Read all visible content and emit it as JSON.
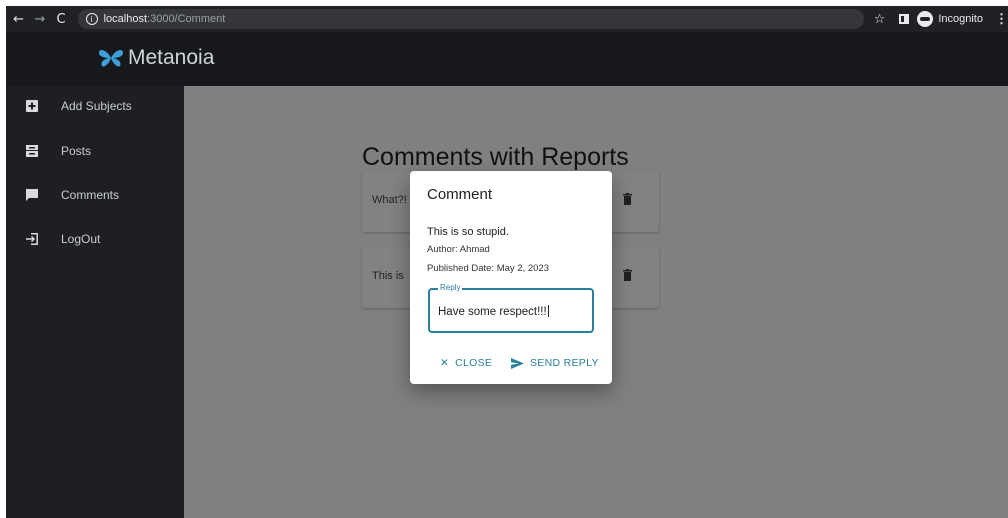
{
  "browser": {
    "back_icon": "arrow-left-icon",
    "forward_icon": "arrow-right-icon",
    "reload_icon": "reload-icon",
    "url_host": "localhost",
    "url_path": ":3000/Comment",
    "profile_label": "Incognito"
  },
  "app": {
    "brand": "Metanoia",
    "brand_color": "#3ca0d9"
  },
  "sidebar": {
    "items": [
      {
        "label": "Add Subjects",
        "icon": "plus-box-icon"
      },
      {
        "label": "Posts",
        "icon": "inbox-icon"
      },
      {
        "label": "Comments",
        "icon": "comment-icon"
      },
      {
        "label": "LogOut",
        "icon": "logout-icon"
      }
    ]
  },
  "main": {
    "title": "Comments with Reports",
    "cards": [
      {
        "text": "What?!"
      },
      {
        "text": "This is"
      }
    ]
  },
  "dialog": {
    "title": "Comment",
    "body": "This is so stupid.",
    "author": "Author: Ahmad",
    "published": "Published Date: May 2, 2023",
    "reply_label": "Reply",
    "reply_value": "Have some respect!!!",
    "close_label": "CLOSE",
    "send_label": "SEND REPLY",
    "accent_color": "#2a7f9e"
  }
}
